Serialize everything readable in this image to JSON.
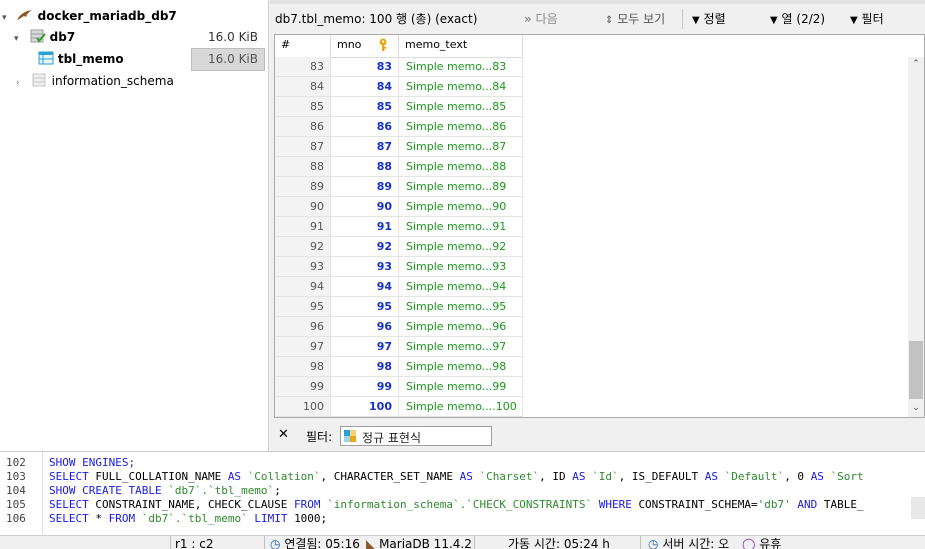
{
  "tree": {
    "connection": "docker_mariadb_db7",
    "database": {
      "name": "db7",
      "size": "16.0 KiB"
    },
    "table": {
      "name": "tbl_memo",
      "size": "16.0 KiB"
    },
    "schema": "information_schema"
  },
  "toolbar": {
    "title": "db7.tbl_memo: 100 행 (총) (exact)",
    "next": "다음",
    "show_all": "모두 보기",
    "sort": "정렬",
    "columns": "열 (2/2)",
    "filter": "필터"
  },
  "grid": {
    "headers": [
      "#",
      "mno",
      "memo_text"
    ],
    "rows": [
      {
        "num": "83",
        "mno": "83",
        "text": "Simple memo...83"
      },
      {
        "num": "84",
        "mno": "84",
        "text": "Simple memo...84"
      },
      {
        "num": "85",
        "mno": "85",
        "text": "Simple memo...85"
      },
      {
        "num": "86",
        "mno": "86",
        "text": "Simple memo...86"
      },
      {
        "num": "87",
        "mno": "87",
        "text": "Simple memo...87"
      },
      {
        "num": "88",
        "mno": "88",
        "text": "Simple memo...88"
      },
      {
        "num": "89",
        "mno": "89",
        "text": "Simple memo...89"
      },
      {
        "num": "90",
        "mno": "90",
        "text": "Simple memo...90"
      },
      {
        "num": "91",
        "mno": "91",
        "text": "Simple memo...91"
      },
      {
        "num": "92",
        "mno": "92",
        "text": "Simple memo...92"
      },
      {
        "num": "93",
        "mno": "93",
        "text": "Simple memo...93"
      },
      {
        "num": "94",
        "mno": "94",
        "text": "Simple memo...94"
      },
      {
        "num": "95",
        "mno": "95",
        "text": "Simple memo...95"
      },
      {
        "num": "96",
        "mno": "96",
        "text": "Simple memo...96"
      },
      {
        "num": "97",
        "mno": "97",
        "text": "Simple memo...97"
      },
      {
        "num": "98",
        "mno": "98",
        "text": "Simple memo...98"
      },
      {
        "num": "99",
        "mno": "99",
        "text": "Simple memo...99"
      },
      {
        "num": "100",
        "mno": "100",
        "text": "Simple memo....100"
      }
    ]
  },
  "filterbar": {
    "close": "✕",
    "label": "필터:",
    "placeholder": "정규 표현식"
  },
  "sqllog": {
    "lines": [
      {
        "no": "102",
        "segs": [
          [
            "kw",
            "SHOW ENGINES;"
          ]
        ]
      },
      {
        "no": "103",
        "segs": [
          [
            "kw",
            "SELECT "
          ],
          [
            "t",
            "FULL_COLLATION_NAME "
          ],
          [
            "kw",
            "AS "
          ],
          [
            "str",
            "`Collation`"
          ],
          [
            "t",
            ", CHARACTER_SET_NAME "
          ],
          [
            "kw",
            "AS "
          ],
          [
            "str",
            "`Charset`"
          ],
          [
            "t",
            ", ID "
          ],
          [
            "kw",
            "AS "
          ],
          [
            "str",
            "`Id`"
          ],
          [
            "t",
            ", IS_DEFAULT "
          ],
          [
            "kw",
            "AS "
          ],
          [
            "str",
            "`Default`"
          ],
          [
            "t",
            ", 0 "
          ],
          [
            "kw",
            "AS "
          ],
          [
            "str",
            "`Sort"
          ]
        ]
      },
      {
        "no": "104",
        "segs": [
          [
            "kw",
            "SHOW CREATE TABLE "
          ],
          [
            "str",
            "`db7`.`tbl_memo`"
          ],
          [
            "t",
            ";"
          ]
        ]
      },
      {
        "no": "105",
        "segs": [
          [
            "kw",
            "SELECT "
          ],
          [
            "t",
            "CONSTRAINT_NAME, CHECK_CLAUSE "
          ],
          [
            "kw",
            "FROM "
          ],
          [
            "str",
            "`information_schema`.`CHECK_CONSTRAINTS`"
          ],
          [
            "kw",
            " WHERE "
          ],
          [
            "t",
            "CONSTRAINT_SCHEMA="
          ],
          [
            "str",
            "'db7'"
          ],
          [
            "kw",
            " AND "
          ],
          [
            "t",
            "TABLE_"
          ]
        ]
      },
      {
        "no": "106",
        "segs": [
          [
            "kw",
            "SELECT "
          ],
          [
            "t",
            "* "
          ],
          [
            "kw",
            "FROM "
          ],
          [
            "str",
            "`db7`.`tbl_memo`"
          ],
          [
            "kw",
            " LIMIT "
          ],
          [
            "t",
            "1000;"
          ]
        ]
      }
    ]
  },
  "status": {
    "cursor": "r1 : c2",
    "connected": "연결됨: 05:16",
    "server": "MariaDB 11.4.2",
    "uptime": "가동 시간: 05:24 h",
    "server_time": "서버 시간: 오",
    "idle": "유휴"
  },
  "colors": {
    "mno": "#1630c8",
    "memo_text": "#1a9a1a",
    "key": "#e6a817",
    "keyword": "#1a1ae6",
    "string": "#2e8b2e"
  }
}
